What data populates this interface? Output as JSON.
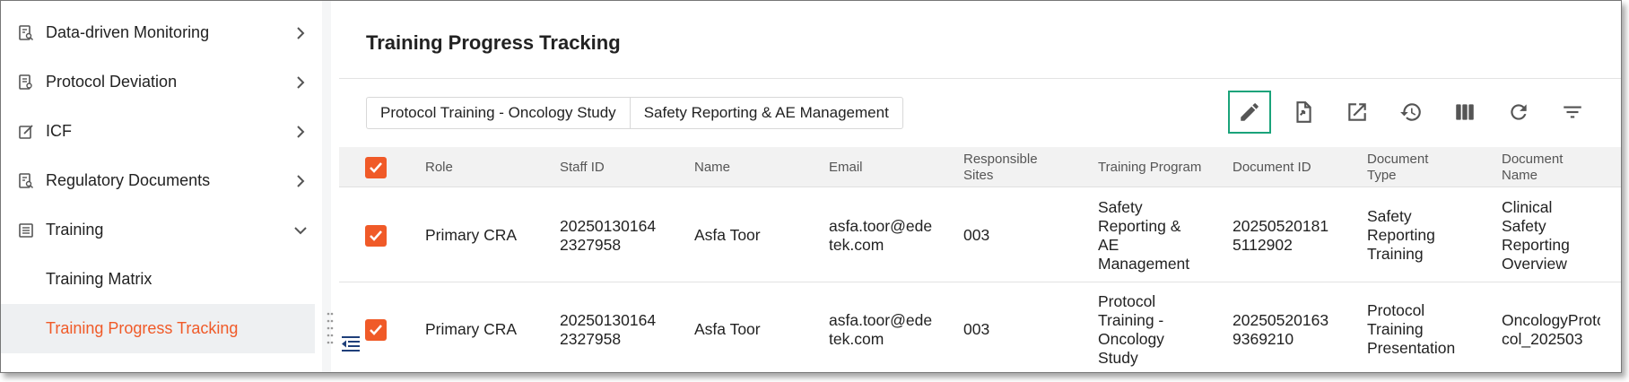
{
  "sidebar": {
    "items": [
      {
        "label": "Data-driven Monitoring",
        "icon": "report-search-icon"
      },
      {
        "label": "Protocol Deviation",
        "icon": "report-icon"
      },
      {
        "label": "ICF",
        "icon": "edit-document-icon"
      },
      {
        "label": "Regulatory Documents",
        "icon": "report-search-icon"
      },
      {
        "label": "Training",
        "icon": "list-icon"
      }
    ],
    "sub_items": [
      "Training Matrix",
      "Training Progress Tracking"
    ]
  },
  "page": {
    "title": "Training Progress Tracking"
  },
  "tabs": [
    "Protocol Training - Oncology Study",
    "Safety Reporting & AE Management"
  ],
  "table": {
    "headers": {
      "role": "Role",
      "staff_id": "Staff ID",
      "name": "Name",
      "email": "Email",
      "sites": "Responsible\nSites",
      "program": "Training Program",
      "doc_id": "Document ID",
      "doc_type": "Document\nType",
      "doc_name": "Document\nName"
    },
    "rows": [
      {
        "role": "Primary CRA",
        "staff_id": "20250130164\n2327958",
        "name": "Asfa Toor",
        "email": "asfa.toor@ede\ntek.com",
        "sites": "003",
        "program": "Safety\nReporting &\nAE\nManagement",
        "doc_id": "20250520181\n5112902",
        "doc_type": "Safety\nReporting\nTraining",
        "doc_name": "Clinical Safety\nReporting\nOverview"
      },
      {
        "role": "Primary CRA",
        "staff_id": "20250130164\n2327958",
        "name": "Asfa Toor",
        "email": "asfa.toor@ede\ntek.com",
        "sites": "003",
        "program": "Protocol\nTraining -\nOncology\nStudy",
        "doc_id": "20250520163\n9369210",
        "doc_type": "Protocol\nTraining\nPresentation",
        "doc_name": "OncologyProto\ncol_202503"
      }
    ]
  },
  "colors": {
    "accent": "#f05a28",
    "highlight": "#1aa37a"
  }
}
